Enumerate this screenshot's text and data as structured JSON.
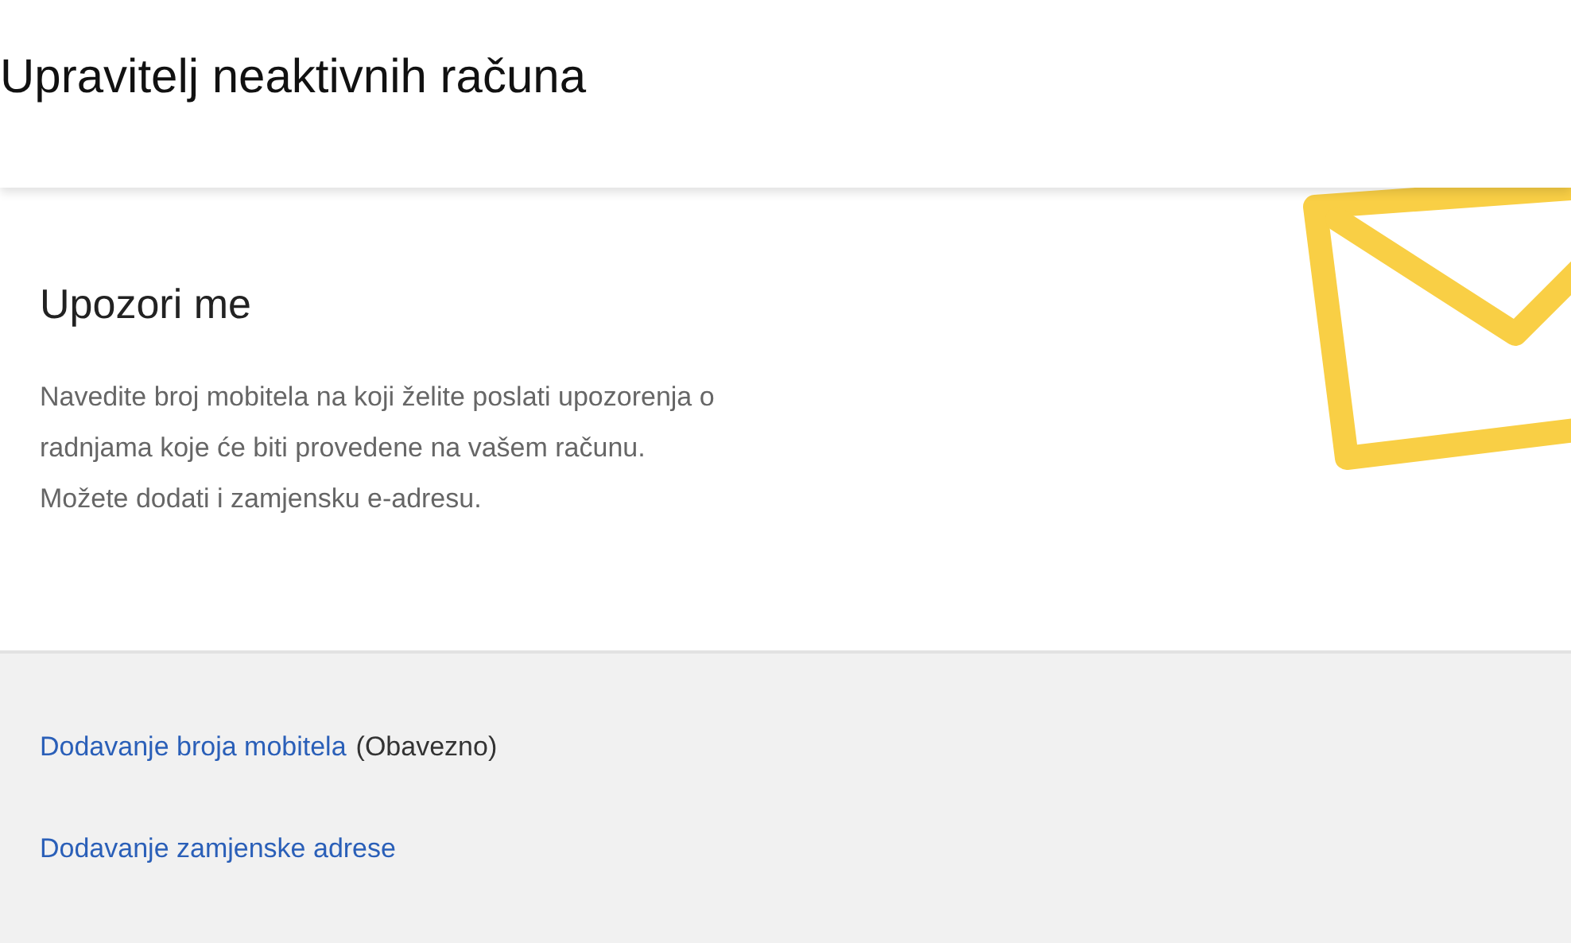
{
  "header": {
    "title": "Upravitelj neaktivnih računa"
  },
  "section": {
    "heading": "Upozori me",
    "description_lines": [
      "Navedite broj mobitela na koji želite poslati upozorenja o",
      "radnjama koje će biti provedene na vašem računu.",
      "Možete dodati i zamjensku e-adresu."
    ]
  },
  "actions": [
    {
      "link": "Dodavanje broja mobitela",
      "note": "(Obavezno)"
    },
    {
      "link": "Dodavanje zamjenske adrese"
    }
  ]
}
